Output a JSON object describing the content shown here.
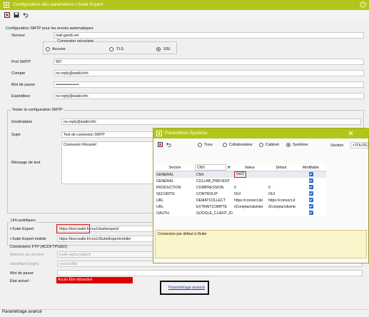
{
  "window": {
    "title": "Configuration des paramètres i-Suite Expert"
  },
  "smtp": {
    "section_title": "Configuration SMTP pour les envois automatiques",
    "server_label": "Serveur",
    "server_value": "mail.gandi.net",
    "secure_group_label": "Connexion sécurisée",
    "secure_options": [
      "Aucune",
      "TLS",
      "SSL"
    ],
    "port_label": "Port SMTP",
    "port_value": "587",
    "account_label": "Compte",
    "account_value": "no-reply@waibi.info",
    "password_label": "Mot de passe",
    "password_value": "••••••••••••••••••",
    "sender_label": "Expéditeur",
    "sender_value": "no-reply@waibi.info"
  },
  "test": {
    "section_title": "Tester la configuration SMTP",
    "recipient_label": "Destinataire",
    "recipient_value": "no-reply@waibi.info",
    "subject_label": "Sujet",
    "subject_value": "Test de connexion SMTP",
    "message_label": "Message de test",
    "message_value": "Connexion  Réussie!"
  },
  "urls": {
    "section_title": "Urls publiques",
    "expert_label": "i-Suite Expert",
    "expert_value": "https://test.waibi.fr/cnx1/isuiteexpert/",
    "mobile_label": "i-Suite Expert mobile",
    "mobile_value": "https://test.waibi.fr/cnx1/iSuiteExpertmobile/"
  },
  "ftp": {
    "section_title": "Connexions FTP (ACDFTPGED)",
    "server_label": "Adresse du serveur",
    "server_value": "isuite-alpha.waibi.fr",
    "login_label": "Identifiant (login)",
    "login_value": "cnx1acdftp",
    "password_label": "Mot de passe",
    "state_label": "Etat actuel :",
    "state_value": "Accès  Être désactivé"
  },
  "footer": {
    "advanced_link": "Paramétrage avancé",
    "status_text": "Paramétrage avancé"
  },
  "dialog": {
    "title": "Paramètres Système",
    "filter_options": [
      "Tous",
      "Collaborateur",
      "Cabinet",
      "Système"
    ],
    "search_value": "CNX",
    "section_label": "Section",
    "section_select": "<TOUTES>",
    "columns": [
      "Section",
      "",
      "Valeur",
      "Défaut",
      "Modifiable"
    ],
    "rows": [
      {
        "section": "GENERAL",
        "name": "CNX",
        "value": "cnx1",
        "default": "",
        "modifiable": true
      },
      {
        "section": "GENERAL",
        "name": "COLLAB_PREVENT",
        "value": "",
        "default": "",
        "modifiable": true
      },
      {
        "section": "PRODUCTION",
        "name": "COMPRESSION",
        "value": "0",
        "default": "0",
        "modifiable": true
      },
      {
        "section": "SECURITE",
        "name": "CONTROLIP",
        "value": "OUI",
        "default": "OUI",
        "modifiable": true
      },
      {
        "section": "URL",
        "name": "DEMATCOLLECT",
        "value": "https://connect.de",
        "default": "https://connect.d",
        "modifiable": true
      },
      {
        "section": "URL",
        "name": "EXTRAITCOMPTE",
        "value": "/iCompta/cdwinter",
        "default": "/iCompta/cdwinte",
        "modifiable": true
      },
      {
        "section": "OAUTH",
        "name": "GOOGLE_CLIENT_ID",
        "value": "",
        "default": "",
        "modifiable": true
      }
    ],
    "description": "Connexion par défaut à iSuite"
  },
  "colors": {
    "accent": "#b2c51b",
    "highlight": "#e01010",
    "state_bg": "#e00000"
  }
}
